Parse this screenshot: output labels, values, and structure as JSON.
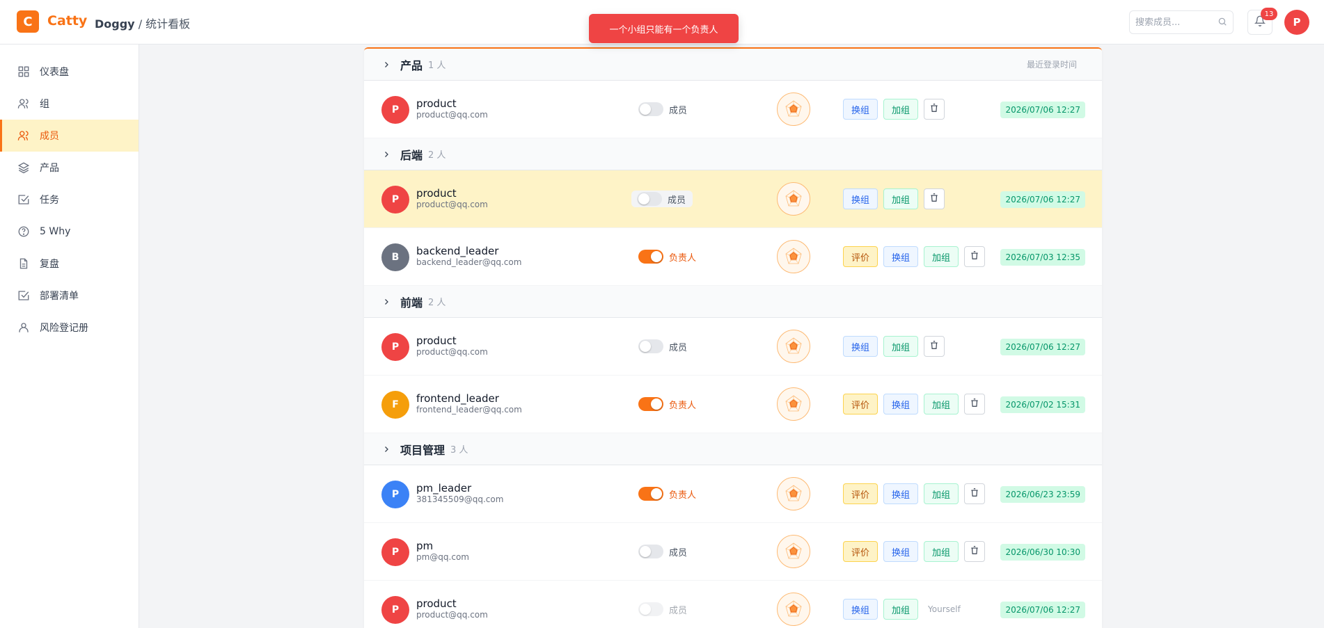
{
  "header": {
    "logo_letter": "C",
    "brand": "Catty",
    "breadcrumb_project": "Doggy",
    "breadcrumb_sep": " / ",
    "breadcrumb_page": "统计看板",
    "search_placeholder": "搜索成员...",
    "notification_count": "13",
    "user_initial": "P"
  },
  "toast": "一个小组只能有一个负责人",
  "sidebar": {
    "items": [
      {
        "label": "仪表盘",
        "icon": "grid-icon"
      },
      {
        "label": "组",
        "icon": "users-icon"
      },
      {
        "label": "成员",
        "icon": "users-icon",
        "active": true
      },
      {
        "label": "产品",
        "icon": "layers-icon"
      },
      {
        "label": "任务",
        "icon": "checkbox-icon"
      },
      {
        "label": "5 Why",
        "icon": "help-circle-icon"
      },
      {
        "label": "复盘",
        "icon": "document-icon"
      },
      {
        "label": "部署清单",
        "icon": "checkbox-icon"
      },
      {
        "label": "风险登记册",
        "icon": "user-icon"
      }
    ]
  },
  "labels": {
    "evaluate": "评价",
    "swap_group": "换组",
    "add_group": "加组",
    "yourself": "Yourself",
    "last_login": "最近登录时间",
    "role_member": "成员",
    "role_leader": "负责人"
  },
  "groups": [
    {
      "name": "产品",
      "count": "1 人",
      "members": [
        {
          "initial": "P",
          "name": "product",
          "email": "product@qq.com",
          "role": "成员",
          "leader": false,
          "time": "2026/07/06 12:27"
        }
      ]
    },
    {
      "name": "后端",
      "count": "2 人",
      "members": [
        {
          "initial": "P",
          "name": "product",
          "email": "product@qq.com",
          "role": "成员",
          "leader": false,
          "time": "2026/07/06 12:27"
        },
        {
          "initial": "B",
          "name": "backend_leader",
          "email": "backend_leader@qq.com",
          "role": "负责人",
          "leader": true,
          "time": "2026/07/03 12:35"
        }
      ]
    },
    {
      "name": "前端",
      "count": "2 人",
      "members": [
        {
          "initial": "P",
          "name": "product",
          "email": "product@qq.com",
          "role": "成员",
          "leader": false,
          "time": "2026/07/06 12:27"
        },
        {
          "initial": "F",
          "name": "frontend_leader",
          "email": "frontend_leader@qq.com",
          "role": "负责人",
          "leader": true,
          "time": "2026/07/02 15:31"
        }
      ]
    },
    {
      "name": "项目管理",
      "count": "3 人",
      "members": [
        {
          "initial": "P",
          "name": "pm_leader",
          "email": "381345509@qq.com",
          "role": "负责人",
          "leader": true,
          "time": "2026/06/23 23:59"
        },
        {
          "initial": "P",
          "name": "pm",
          "email": "pm@qq.com",
          "role": "成员",
          "leader": false,
          "time": "2026/06/30 10:30"
        },
        {
          "initial": "P",
          "name": "product",
          "email": "product@qq.com",
          "role": "成员",
          "leader": false,
          "time": "2026/07/06 12:27"
        }
      ]
    }
  ],
  "colors": {
    "accent": "#f97316",
    "avatar_red": "#ef4444",
    "avatar_gray": "#6b7280",
    "avatar_amber": "#f59e0b",
    "avatar_blue": "#3b82f6"
  }
}
